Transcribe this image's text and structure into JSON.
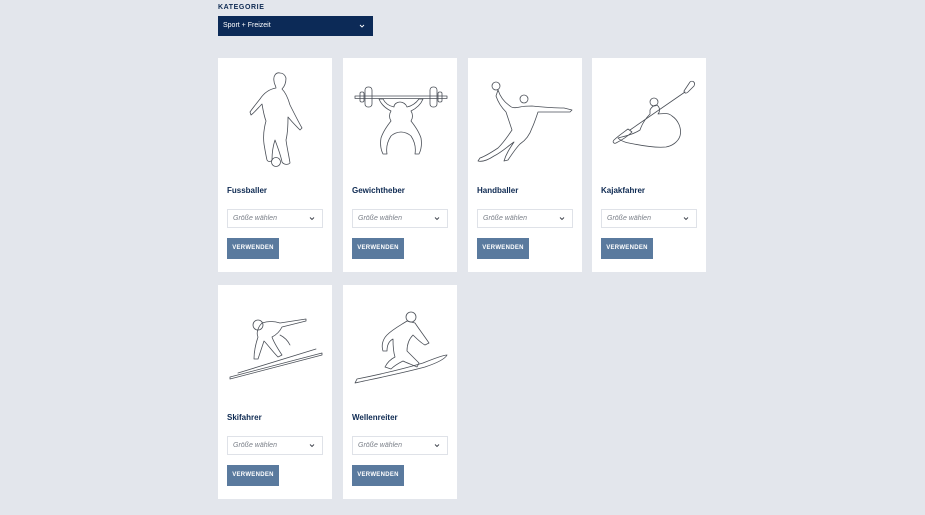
{
  "category": {
    "label": "KATEGORIE",
    "selected": "Sport + Freizeit",
    "chevron_icon": "chevron-down-icon"
  },
  "cards": [
    {
      "name": "Fussballer",
      "size_placeholder": "Größe wählen",
      "button": "VERWENDEN",
      "icon": "footballer-silhouette-icon"
    },
    {
      "name": "Gewichtheber",
      "size_placeholder": "Größe wählen",
      "button": "VERWENDEN",
      "icon": "weightlifter-silhouette-icon"
    },
    {
      "name": "Handballer",
      "size_placeholder": "Größe wählen",
      "button": "VERWENDEN",
      "icon": "handball-player-silhouette-icon"
    },
    {
      "name": "Kajakfahrer",
      "size_placeholder": "Größe wählen",
      "button": "VERWENDEN",
      "icon": "kayaker-silhouette-icon"
    },
    {
      "name": "Skifahrer",
      "size_placeholder": "Größe wählen",
      "button": "VERWENDEN",
      "icon": "skier-silhouette-icon"
    },
    {
      "name": "Wellenreiter",
      "size_placeholder": "Größe wählen",
      "button": "VERWENDEN",
      "icon": "surfer-silhouette-icon"
    }
  ],
  "colors": {
    "background": "#e3e6ec",
    "navy": "#0c2a57",
    "button": "#5a7a9e"
  }
}
